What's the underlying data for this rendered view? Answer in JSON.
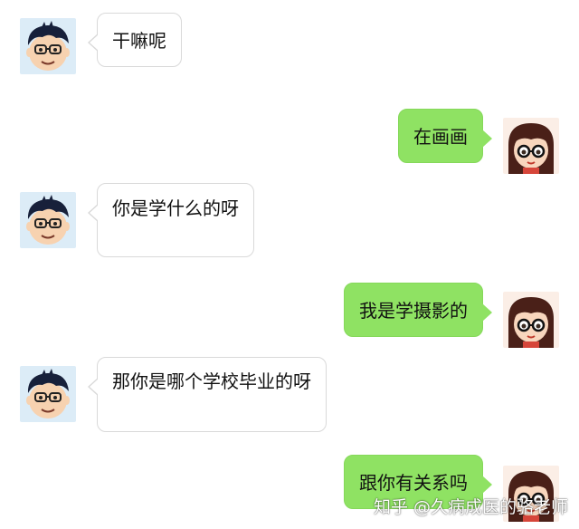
{
  "messages": [
    {
      "side": "in",
      "text": "干嘛呢"
    },
    {
      "side": "out",
      "text": "在画画"
    },
    {
      "side": "in",
      "text": "你是学什么的呀"
    },
    {
      "side": "out",
      "text": "我是学摄影的"
    },
    {
      "side": "in",
      "text": "那你是哪个学校毕业的呀"
    },
    {
      "side": "out",
      "text": "跟你有关系吗"
    }
  ],
  "watermark": {
    "text": "知乎 @久病成医的骆老师"
  },
  "colors": {
    "outgoing_bubble": "#8fe263",
    "incoming_bubble": "#ffffff",
    "background": "#ffffff"
  },
  "avatars": {
    "incoming": "boy-glasses-avatar",
    "outgoing": "girl-glasses-avatar"
  }
}
